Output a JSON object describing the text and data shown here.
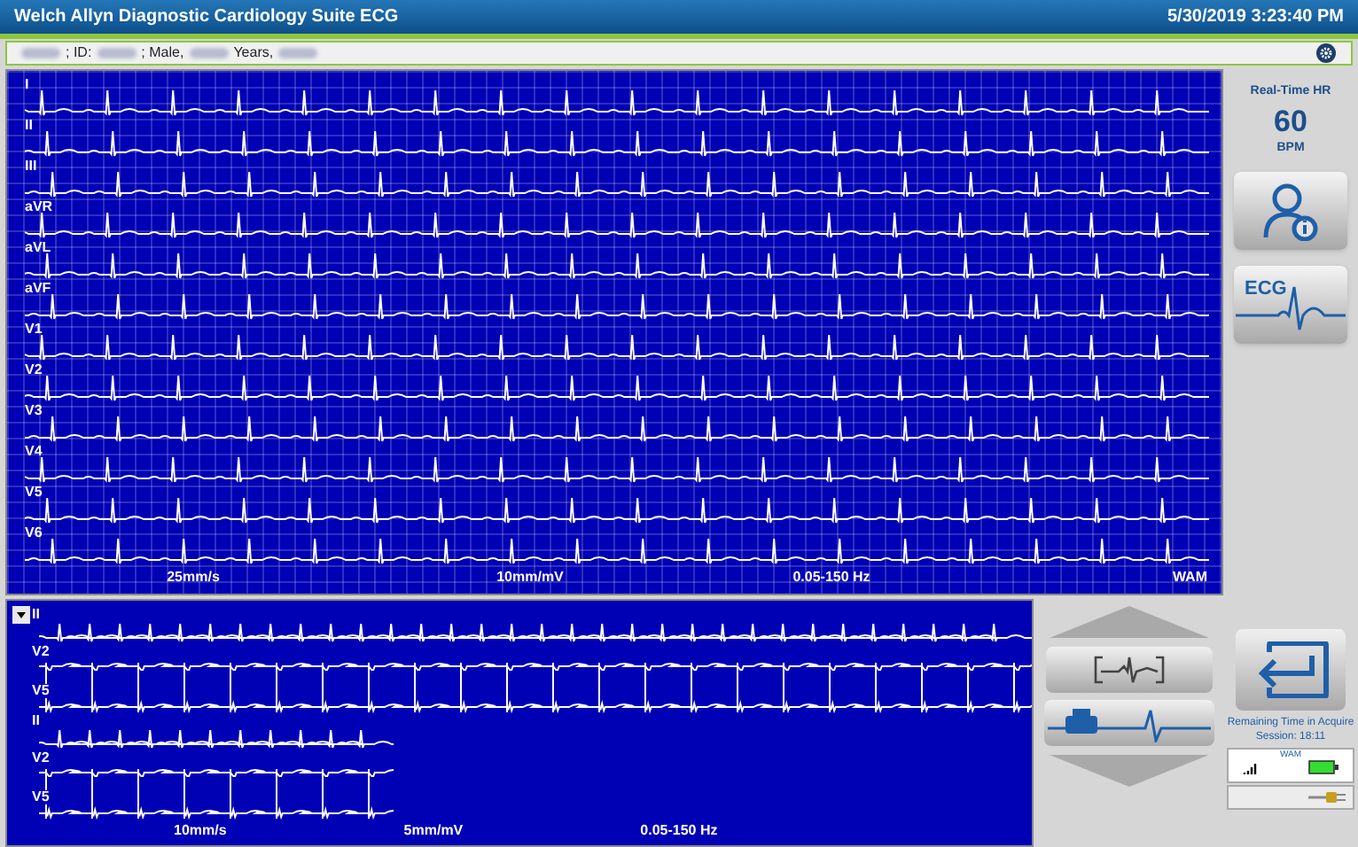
{
  "window": {
    "title": "Welch Allyn Diagnostic Cardiology Suite ECG",
    "datetime": "5/30/2019 3:23:40 PM"
  },
  "patient_bar": {
    "segments": [
      {
        "kind": "redacted"
      },
      {
        "kind": "text",
        "text": "; ID:"
      },
      {
        "kind": "redacted"
      },
      {
        "kind": "text",
        "text": "; Male,"
      },
      {
        "kind": "redacted"
      },
      {
        "kind": "text",
        "text": "Years,"
      },
      {
        "kind": "redacted"
      }
    ]
  },
  "main_display": {
    "leads": [
      "I",
      "II",
      "III",
      "aVR",
      "aVL",
      "aVF",
      "V1",
      "V2",
      "V3",
      "V4",
      "V5",
      "V6"
    ],
    "footer": [
      "25mm/s",
      "10mm/mV",
      "0.05-150 Hz",
      "WAM"
    ]
  },
  "side_panel": {
    "hr_label": "Real-Time HR",
    "hr_value": "60",
    "hr_unit": "BPM",
    "ecg_button": "ECG"
  },
  "rhythm_display": {
    "groups": [
      {
        "strips": [
          {
            "labels": [
              "II"
            ]
          },
          {
            "labels": [
              "V2",
              "V5"
            ]
          }
        ]
      },
      {
        "strips": [
          {
            "labels": [
              "II"
            ]
          },
          {
            "labels": [
              "V2",
              "V5"
            ]
          }
        ]
      }
    ],
    "footer": [
      "10mm/s",
      "5mm/mV",
      "0.05-150 Hz"
    ]
  },
  "controls": {
    "session_text": "Remaining Time in Acquire Session: 18:11",
    "wam_label": "WAM"
  }
}
